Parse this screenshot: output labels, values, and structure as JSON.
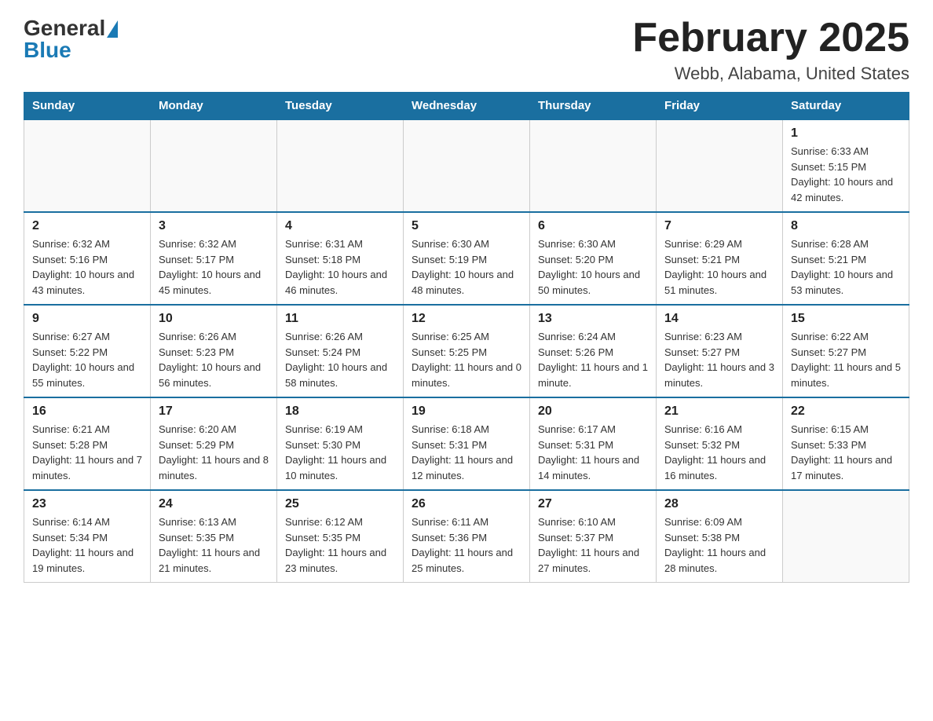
{
  "header": {
    "logo_general": "General",
    "logo_blue": "Blue",
    "month_title": "February 2025",
    "location": "Webb, Alabama, United States"
  },
  "days_of_week": [
    "Sunday",
    "Monday",
    "Tuesday",
    "Wednesday",
    "Thursday",
    "Friday",
    "Saturday"
  ],
  "weeks": [
    [
      {
        "day": "",
        "info": ""
      },
      {
        "day": "",
        "info": ""
      },
      {
        "day": "",
        "info": ""
      },
      {
        "day": "",
        "info": ""
      },
      {
        "day": "",
        "info": ""
      },
      {
        "day": "",
        "info": ""
      },
      {
        "day": "1",
        "info": "Sunrise: 6:33 AM\nSunset: 5:15 PM\nDaylight: 10 hours and 42 minutes."
      }
    ],
    [
      {
        "day": "2",
        "info": "Sunrise: 6:32 AM\nSunset: 5:16 PM\nDaylight: 10 hours and 43 minutes."
      },
      {
        "day": "3",
        "info": "Sunrise: 6:32 AM\nSunset: 5:17 PM\nDaylight: 10 hours and 45 minutes."
      },
      {
        "day": "4",
        "info": "Sunrise: 6:31 AM\nSunset: 5:18 PM\nDaylight: 10 hours and 46 minutes."
      },
      {
        "day": "5",
        "info": "Sunrise: 6:30 AM\nSunset: 5:19 PM\nDaylight: 10 hours and 48 minutes."
      },
      {
        "day": "6",
        "info": "Sunrise: 6:30 AM\nSunset: 5:20 PM\nDaylight: 10 hours and 50 minutes."
      },
      {
        "day": "7",
        "info": "Sunrise: 6:29 AM\nSunset: 5:21 PM\nDaylight: 10 hours and 51 minutes."
      },
      {
        "day": "8",
        "info": "Sunrise: 6:28 AM\nSunset: 5:21 PM\nDaylight: 10 hours and 53 minutes."
      }
    ],
    [
      {
        "day": "9",
        "info": "Sunrise: 6:27 AM\nSunset: 5:22 PM\nDaylight: 10 hours and 55 minutes."
      },
      {
        "day": "10",
        "info": "Sunrise: 6:26 AM\nSunset: 5:23 PM\nDaylight: 10 hours and 56 minutes."
      },
      {
        "day": "11",
        "info": "Sunrise: 6:26 AM\nSunset: 5:24 PM\nDaylight: 10 hours and 58 minutes."
      },
      {
        "day": "12",
        "info": "Sunrise: 6:25 AM\nSunset: 5:25 PM\nDaylight: 11 hours and 0 minutes."
      },
      {
        "day": "13",
        "info": "Sunrise: 6:24 AM\nSunset: 5:26 PM\nDaylight: 11 hours and 1 minute."
      },
      {
        "day": "14",
        "info": "Sunrise: 6:23 AM\nSunset: 5:27 PM\nDaylight: 11 hours and 3 minutes."
      },
      {
        "day": "15",
        "info": "Sunrise: 6:22 AM\nSunset: 5:27 PM\nDaylight: 11 hours and 5 minutes."
      }
    ],
    [
      {
        "day": "16",
        "info": "Sunrise: 6:21 AM\nSunset: 5:28 PM\nDaylight: 11 hours and 7 minutes."
      },
      {
        "day": "17",
        "info": "Sunrise: 6:20 AM\nSunset: 5:29 PM\nDaylight: 11 hours and 8 minutes."
      },
      {
        "day": "18",
        "info": "Sunrise: 6:19 AM\nSunset: 5:30 PM\nDaylight: 11 hours and 10 minutes."
      },
      {
        "day": "19",
        "info": "Sunrise: 6:18 AM\nSunset: 5:31 PM\nDaylight: 11 hours and 12 minutes."
      },
      {
        "day": "20",
        "info": "Sunrise: 6:17 AM\nSunset: 5:31 PM\nDaylight: 11 hours and 14 minutes."
      },
      {
        "day": "21",
        "info": "Sunrise: 6:16 AM\nSunset: 5:32 PM\nDaylight: 11 hours and 16 minutes."
      },
      {
        "day": "22",
        "info": "Sunrise: 6:15 AM\nSunset: 5:33 PM\nDaylight: 11 hours and 17 minutes."
      }
    ],
    [
      {
        "day": "23",
        "info": "Sunrise: 6:14 AM\nSunset: 5:34 PM\nDaylight: 11 hours and 19 minutes."
      },
      {
        "day": "24",
        "info": "Sunrise: 6:13 AM\nSunset: 5:35 PM\nDaylight: 11 hours and 21 minutes."
      },
      {
        "day": "25",
        "info": "Sunrise: 6:12 AM\nSunset: 5:35 PM\nDaylight: 11 hours and 23 minutes."
      },
      {
        "day": "26",
        "info": "Sunrise: 6:11 AM\nSunset: 5:36 PM\nDaylight: 11 hours and 25 minutes."
      },
      {
        "day": "27",
        "info": "Sunrise: 6:10 AM\nSunset: 5:37 PM\nDaylight: 11 hours and 27 minutes."
      },
      {
        "day": "28",
        "info": "Sunrise: 6:09 AM\nSunset: 5:38 PM\nDaylight: 11 hours and 28 minutes."
      },
      {
        "day": "",
        "info": ""
      }
    ]
  ]
}
